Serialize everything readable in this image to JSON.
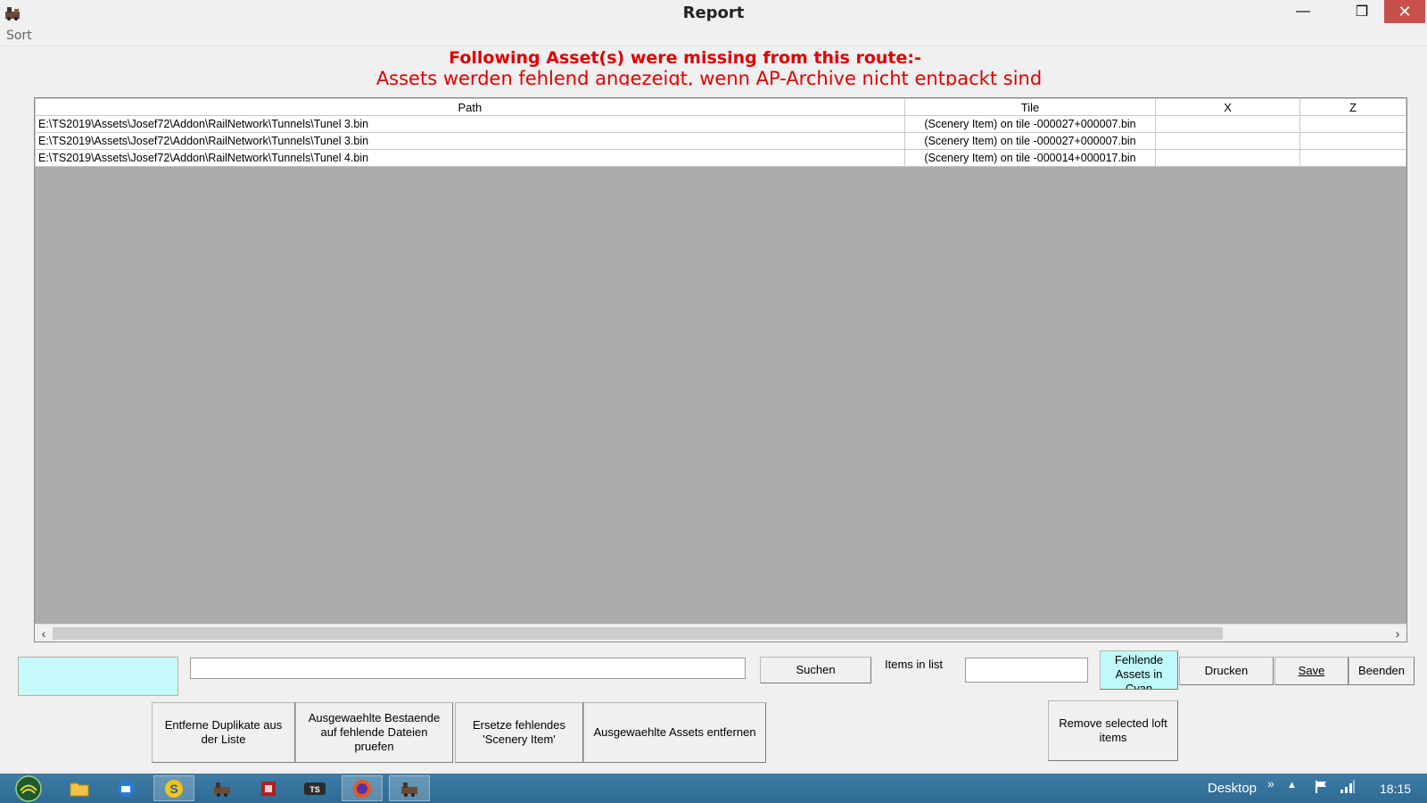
{
  "window": {
    "title": "Report",
    "minimize": "—",
    "maximize": "❒",
    "close": "✕"
  },
  "menu": {
    "items": [
      "Sort"
    ]
  },
  "headline": {
    "line1": "Following Asset(s) were missing from this route:-",
    "line2": "Assets werden fehlend angezeigt, wenn AP-Archive nicht entpackt sind"
  },
  "grid": {
    "columns": [
      "Path",
      "Tile",
      "X",
      "Z"
    ],
    "rows": [
      {
        "path": "E:\\TS2019\\Assets\\Josef72\\Addon\\RailNetwork\\Tunnels\\Tunel 3.bin",
        "tile": "(Scenery Item) on tile -000027+000007.bin",
        "x": "",
        "z": ""
      },
      {
        "path": "E:\\TS2019\\Assets\\Josef72\\Addon\\RailNetwork\\Tunnels\\Tunel 3.bin",
        "tile": "(Scenery Item) on tile -000027+000007.bin",
        "x": "",
        "z": ""
      },
      {
        "path": "E:\\TS2019\\Assets\\Josef72\\Addon\\RailNetwork\\Tunnels\\Tunel 4.bin",
        "tile": "(Scenery Item) on tile -000014+000017.bin",
        "x": "",
        "z": ""
      }
    ]
  },
  "controls": {
    "search_value": "",
    "search_button": "Suchen",
    "items_in_list_label": "Items in list",
    "items_count": "",
    "fehlende_button": "Fehlende Assets in Cyan",
    "drucken_button": "Drucken",
    "save_button": "Save",
    "beenden_button": "Beenden",
    "remove_duplicates_button": "Entferne Duplikate aus der Liste",
    "check_selected_button": "Ausgewaehlte Bestaende auf fehlende Dateien pruefen",
    "replace_missing_button": "Ersetze fehlendes 'Scenery Item'",
    "remove_selected_button": "Ausgewaehlte Assets entfernen",
    "remove_loft_button": "Remove selected loft items"
  },
  "taskbar": {
    "desktop_label": "Desktop",
    "chevron": "»",
    "clock": "18:15"
  },
  "colors": {
    "headline": "#e00000",
    "cyan_highlight": "#c6fafa",
    "taskbar": "#3473a0"
  }
}
